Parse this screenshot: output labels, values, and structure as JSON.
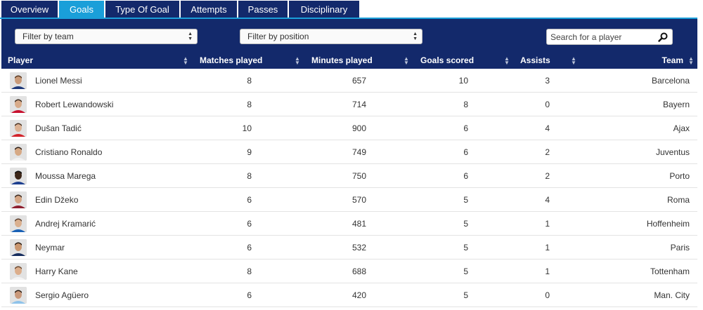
{
  "tabs": [
    "Overview",
    "Goals",
    "Type Of Goal",
    "Attempts",
    "Passes",
    "Disciplinary"
  ],
  "active_tab": "Goals",
  "filters": {
    "team_label": "Filter by team",
    "position_label": "Filter by position",
    "search_placeholder": "Search for a player"
  },
  "columns": [
    "Player",
    "Matches played",
    "Minutes played",
    "Goals scored",
    "Assists",
    "Team"
  ],
  "rows": [
    {
      "player": "Lionel Messi",
      "matches": "8",
      "minutes": "657",
      "goals": "10",
      "assists": "3",
      "team": "Barcelona"
    },
    {
      "player": "Robert Lewandowski",
      "matches": "8",
      "minutes": "714",
      "goals": "8",
      "assists": "0",
      "team": "Bayern"
    },
    {
      "player": "Dušan Tadić",
      "matches": "10",
      "minutes": "900",
      "goals": "6",
      "assists": "4",
      "team": "Ajax"
    },
    {
      "player": "Cristiano Ronaldo",
      "matches": "9",
      "minutes": "749",
      "goals": "6",
      "assists": "2",
      "team": "Juventus"
    },
    {
      "player": "Moussa Marega",
      "matches": "8",
      "minutes": "750",
      "goals": "6",
      "assists": "2",
      "team": "Porto"
    },
    {
      "player": "Edin Džeko",
      "matches": "6",
      "minutes": "570",
      "goals": "5",
      "assists": "4",
      "team": "Roma"
    },
    {
      "player": "Andrej Kramarić",
      "matches": "6",
      "minutes": "481",
      "goals": "5",
      "assists": "1",
      "team": "Hoffenheim"
    },
    {
      "player": "Neymar",
      "matches": "6",
      "minutes": "532",
      "goals": "5",
      "assists": "1",
      "team": "Paris"
    },
    {
      "player": "Harry Kane",
      "matches": "8",
      "minutes": "688",
      "goals": "5",
      "assists": "1",
      "team": "Tottenham"
    },
    {
      "player": "Sergio Agüero",
      "matches": "6",
      "minutes": "420",
      "goals": "5",
      "assists": "0",
      "team": "Man. City"
    }
  ],
  "icons": {
    "search": "search-icon",
    "sort": "sort-arrows-icon",
    "select": "select-arrows-icon",
    "avatar": "player-avatar"
  },
  "colors": {
    "navy": "#13296b",
    "accent": "#1a9fd9"
  }
}
